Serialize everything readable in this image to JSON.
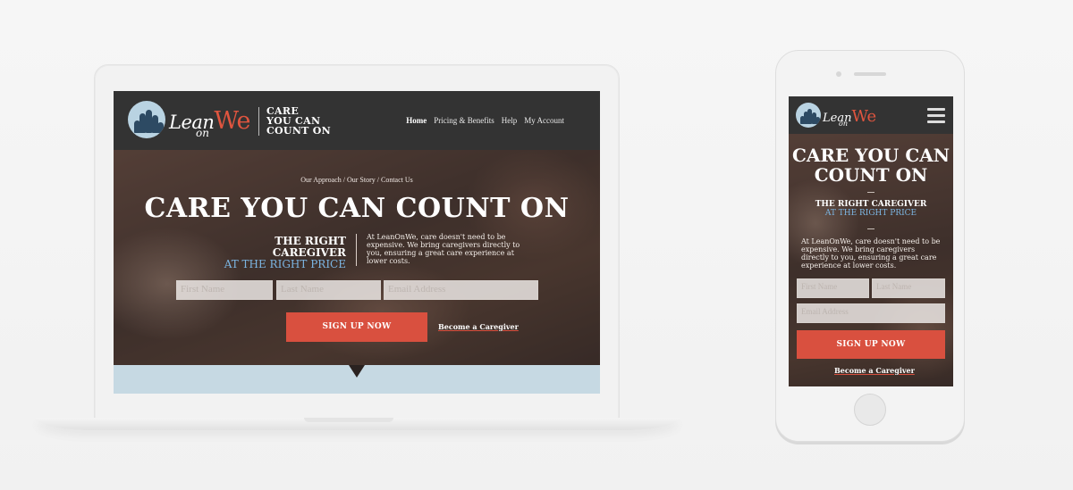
{
  "site": {
    "brand_lean": "Lean",
    "brand_on": "on",
    "brand_we": "We",
    "tagline": [
      "CARE",
      "YOU CAN",
      "COUNT ON"
    ],
    "nav": [
      "Home",
      "Pricing & Benefits",
      "Help",
      "My Account"
    ],
    "breadcrumb": "Our Approach / Our Story / Contact Us",
    "headline": "CARE YOU CAN COUNT ON",
    "sub_line1": "THE RIGHT CAREGIVER",
    "sub_line2": "AT THE RIGHT PRICE",
    "body": "At LeanOnWe, care doesn't need to be expensive. We bring caregivers directly to you, ensuring a great care experience at lower costs.",
    "form": {
      "first_name_placeholder": "First Name",
      "last_name_placeholder": "Last Name",
      "email_placeholder": "Email Address",
      "signup_label": "SIGN UP NOW",
      "caregiver_link": "Become a Caregiver"
    }
  },
  "mobile": {
    "headline_l1": "CARE YOU CAN",
    "headline_l2": "COUNT ON"
  },
  "colors": {
    "accent": "#d9503f",
    "highlight": "#7cb5e2",
    "header_bg": "#333333",
    "footer_band": "#c6d9e3"
  },
  "icons": {
    "menu": "hamburger-icon",
    "logo": "family-logo-icon"
  }
}
